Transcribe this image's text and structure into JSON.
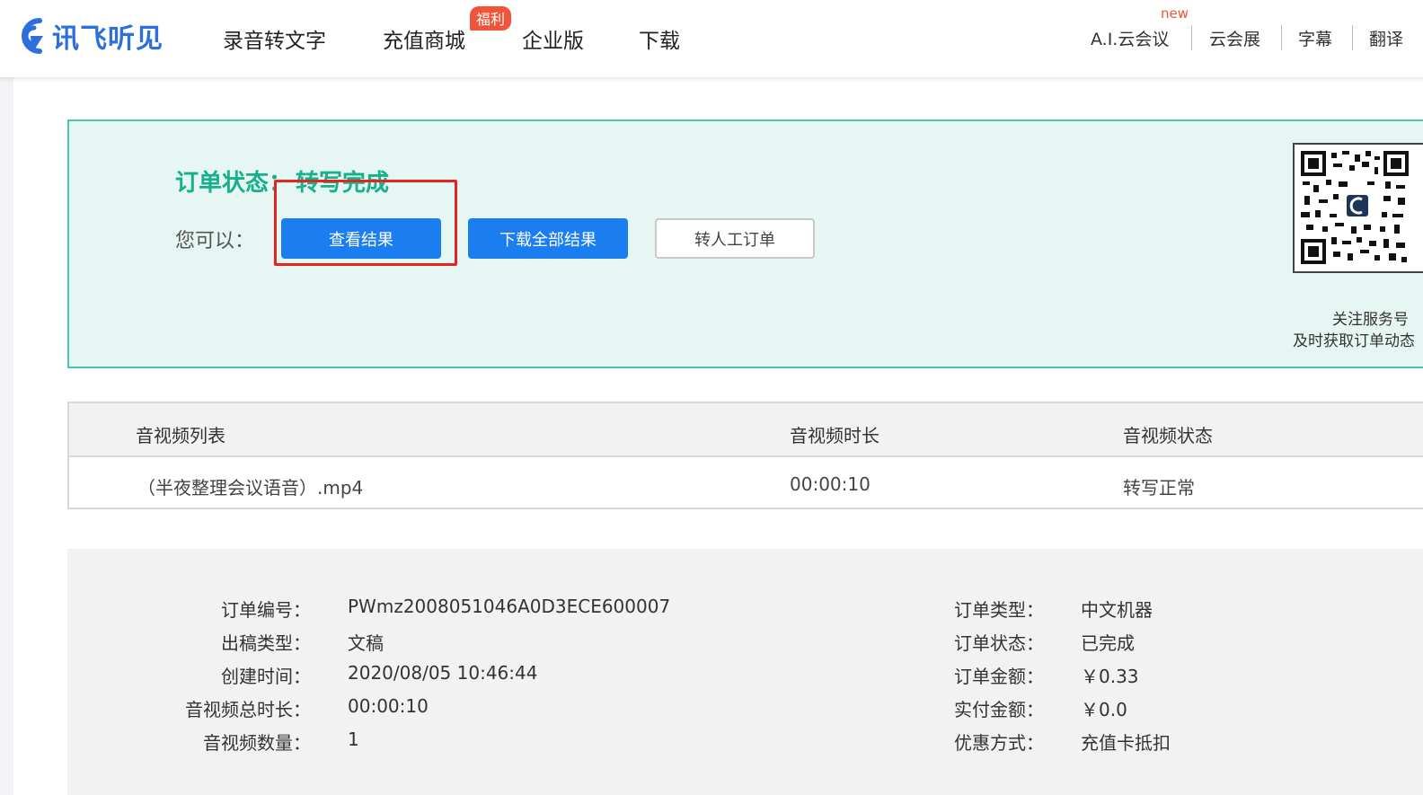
{
  "header": {
    "logo_text": "讯飞听见",
    "nav": [
      "录音转文字",
      "充值商城",
      "企业版",
      "下载"
    ],
    "hot_badge": "福利",
    "new_badge": "new",
    "right_links": [
      "A.I.云会议",
      "云会展",
      "字幕",
      "翻译"
    ]
  },
  "status": {
    "label": "订单状态：",
    "value": "转写完成",
    "can_label": "您可以：",
    "buttons": {
      "view_result": "查看结果",
      "download_all": "下载全部结果",
      "manual_order": "转人工订单"
    },
    "qr_caption_line1": "关注服务号",
    "qr_caption_line2": "及时获取订单动态"
  },
  "table": {
    "headers": [
      "音视频列表",
      "音视频时长",
      "音视频状态"
    ],
    "rows": [
      {
        "name": "（半夜整理会议语音）.mp4",
        "duration": "00:00:10",
        "state": "转写正常"
      }
    ]
  },
  "details": {
    "left": [
      {
        "label": "订单编号：",
        "value": "PWmz2008051046A0D3ECE600007"
      },
      {
        "label": "出稿类型：",
        "value": "文稿"
      },
      {
        "label": "创建时间：",
        "value": "2020/08/05 10:46:44"
      },
      {
        "label": "音视频总时长：",
        "value": "00:00:10"
      },
      {
        "label": "音视频数量：",
        "value": "1"
      }
    ],
    "right": [
      {
        "label": "订单类型：",
        "value": "中文机器"
      },
      {
        "label": "订单状态：",
        "value": "已完成"
      },
      {
        "label": "订单金额：",
        "value": "￥0.33"
      },
      {
        "label": "实付金额：",
        "value": "￥0.0"
      },
      {
        "label": "优惠方式：",
        "value": "充值卡抵扣"
      }
    ]
  },
  "colors": {
    "brand_blue": "#1a7ef0",
    "status_green": "#16b08c",
    "panel_bg": "#e5f6f3",
    "highlight_red": "#e5231f"
  }
}
